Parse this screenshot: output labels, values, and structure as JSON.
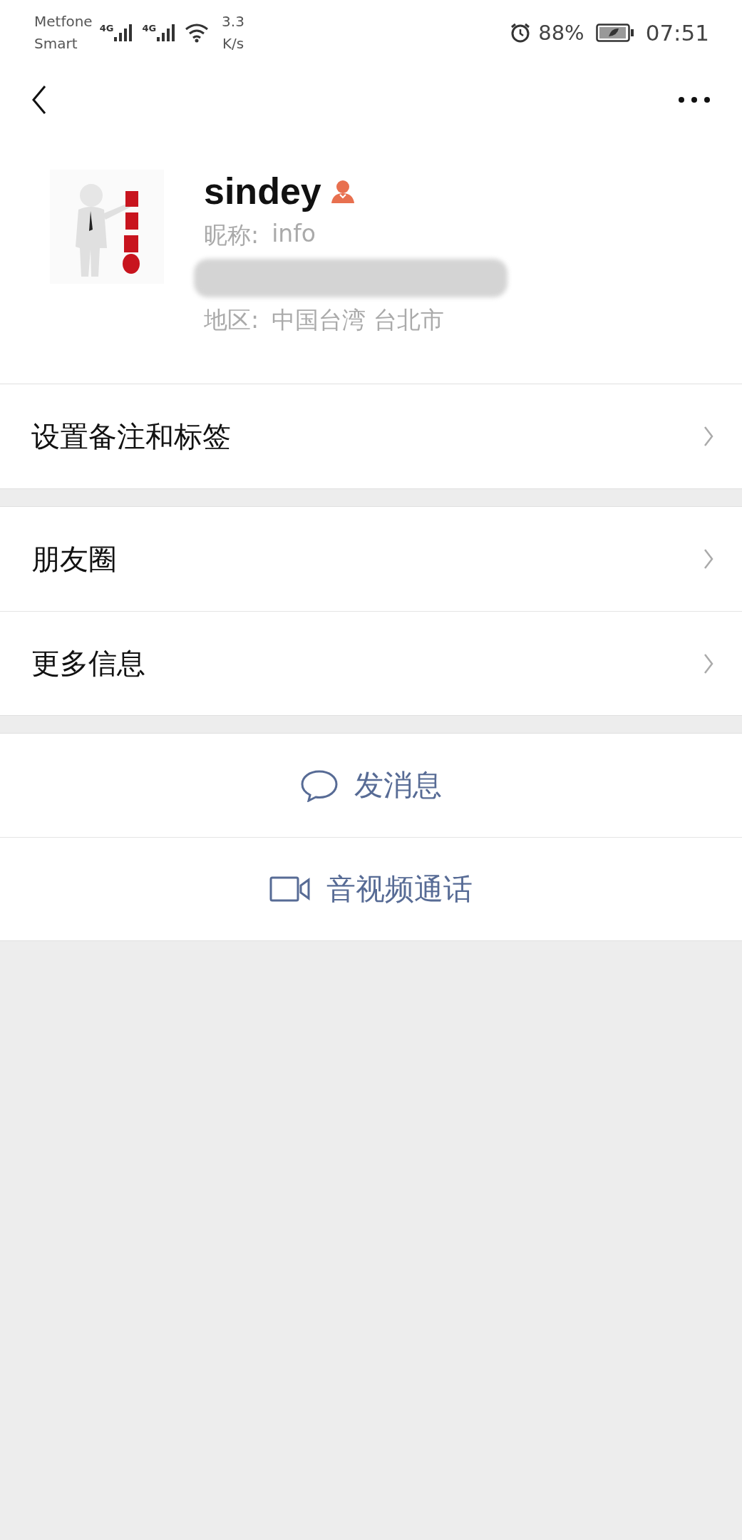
{
  "status_bar": {
    "carrier": [
      "Metfone",
      "Smart"
    ],
    "network_labels": [
      "4G",
      "4G"
    ],
    "speed": [
      "3.3",
      "K/s"
    ],
    "battery": "88%",
    "time": "07:51"
  },
  "profile": {
    "name": "sindey",
    "nickname_label": "昵称:",
    "nickname": "info",
    "region_label": "地区:",
    "region": "中国台湾  台北市"
  },
  "menu_groups": [
    [
      {
        "label": "设置备注和标签"
      }
    ],
    [
      {
        "label": "朋友圈"
      },
      {
        "label": "更多信息"
      }
    ]
  ],
  "actions": [
    {
      "kind": "message",
      "label": "发消息"
    },
    {
      "kind": "call",
      "label": "音视频通话"
    }
  ]
}
